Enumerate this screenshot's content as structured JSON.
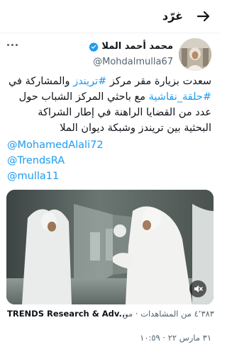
{
  "header": {
    "title": "غرّد",
    "back_icon": "arrow-right-icon"
  },
  "tweet": {
    "author_name": "محمد أحمد الملا",
    "handle": "@Mohdalmulla67",
    "verified": true,
    "verified_color": "#1d9bf0",
    "text": {
      "line1_part1": "سعدت بزيارة مقر مركز ",
      "hashtag1": "#تريندز",
      "line1_part2": " والمشاركة في",
      "hashtag2": "#حلقة_نقاشية",
      "line2_rest": " مع باحثي المركز الشباب حول عدد من القضايا الراهنة في إطار الشراكة البحثية بين تريندز وشبكة ديوان الملا"
    },
    "mentions": [
      "@MohamedAlali72",
      "@TrendsRA",
      "@mulla11"
    ],
    "link_color": "#1d9bf0",
    "media": {
      "type": "video",
      "mute_icon": "speaker-muted-icon"
    },
    "attribution": {
      "source": "TRENDS Research & Adv...",
      "views": "٤٬٣٨٣ من المشاهدات · من"
    },
    "timestamp": "٣١ مارس ٢٢ · ١٠:٥٩"
  }
}
